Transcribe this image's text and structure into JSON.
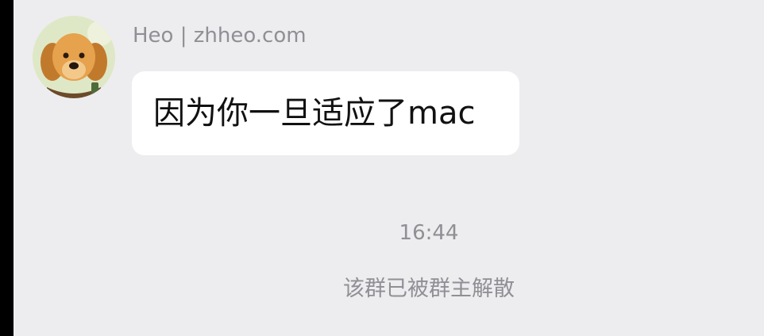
{
  "message": {
    "sender": "Heo | zhheo.com",
    "text": "因为你一旦适应了mac",
    "avatar_icon": "golden-retriever-dog-avatar"
  },
  "timestamp": "16:44",
  "system_notice": "该群已被群主解散",
  "colors": {
    "background": "#ededf0",
    "bubble": "#ffffff",
    "muted_text": "#8f8f94",
    "message_text": "#111111"
  }
}
